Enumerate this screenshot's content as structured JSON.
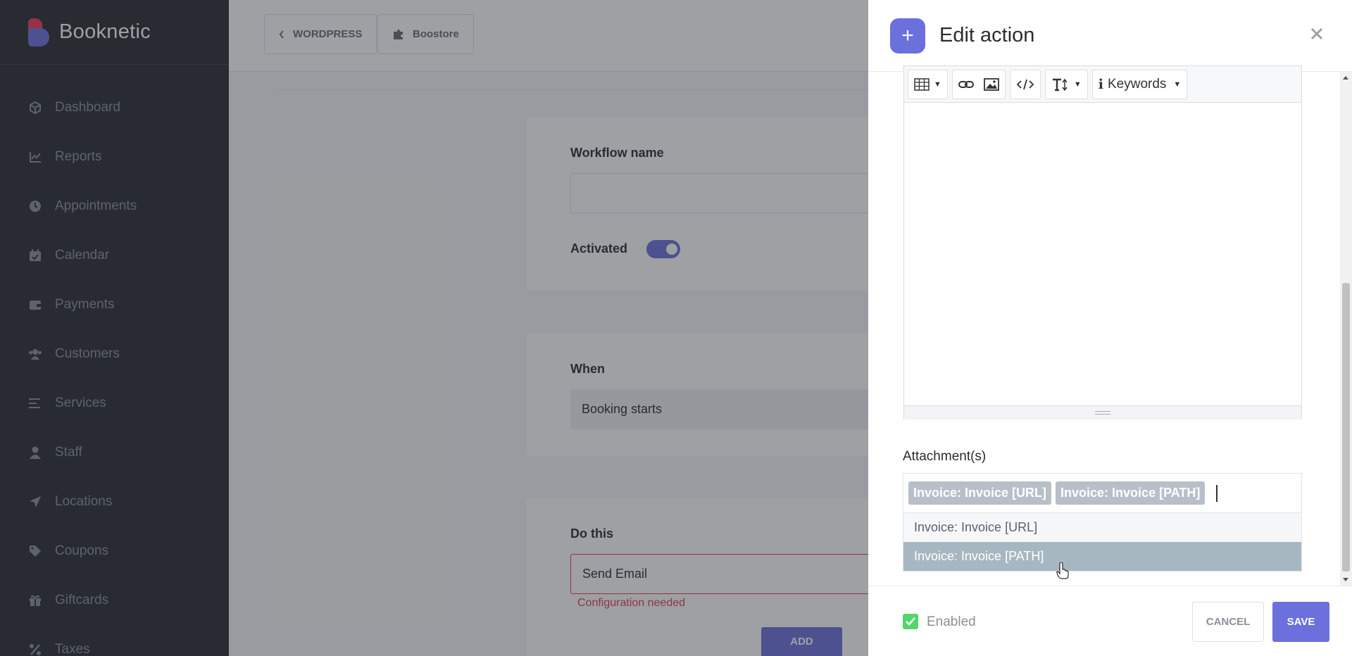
{
  "brand": {
    "name": "Booknetic"
  },
  "sidebar": {
    "items": [
      {
        "label": "Dashboard",
        "icon": "cube-icon"
      },
      {
        "label": "Reports",
        "icon": "chart-line-icon"
      },
      {
        "label": "Appointments",
        "icon": "clock-icon"
      },
      {
        "label": "Calendar",
        "icon": "calendar-check-icon"
      },
      {
        "label": "Payments",
        "icon": "wallet-icon"
      },
      {
        "label": "Customers",
        "icon": "users-icon"
      },
      {
        "label": "Services",
        "icon": "list-icon"
      },
      {
        "label": "Staff",
        "icon": "user-icon"
      },
      {
        "label": "Locations",
        "icon": "location-arrow-icon"
      },
      {
        "label": "Coupons",
        "icon": "tag-icon"
      },
      {
        "label": "Giftcards",
        "icon": "gift-icon"
      },
      {
        "label": "Taxes",
        "icon": "percent-icon"
      }
    ]
  },
  "topbar": {
    "wordpress_label": "WORDPRESS",
    "boostore_label": "Boostore"
  },
  "workflow": {
    "name_label": "Workflow name",
    "name_value": "",
    "activated_label": "Activated",
    "activated": true,
    "when_label": "When",
    "when_value": "Booking starts",
    "do_label": "Do this",
    "do_value": "Send Email",
    "error_text": "Configuration needed",
    "add_label": "ADD"
  },
  "panel": {
    "title": "Edit action",
    "toolbar": {
      "keywords_label": "Keywords"
    },
    "attachments_label": "Attachment(s)",
    "selected_tags": [
      "Invoice: Invoice [URL]",
      "Invoice: Invoice [PATH]"
    ],
    "options": [
      "Invoice: Invoice [URL]",
      "Invoice: Invoice [PATH]"
    ],
    "enabled_label": "Enabled",
    "cancel_label": "CANCEL",
    "save_label": "SAVE"
  },
  "colors": {
    "accent": "#6c70dc",
    "sidebar": "#292d32",
    "error": "#e63c52",
    "check": "#53d56c"
  }
}
